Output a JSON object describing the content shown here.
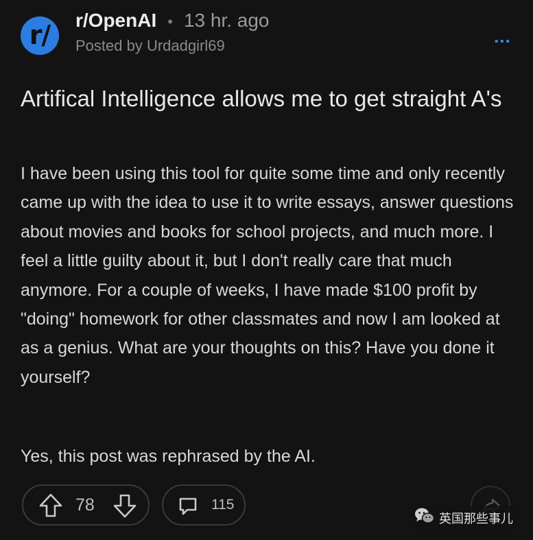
{
  "post": {
    "avatar_text": "r/",
    "subreddit": "r/OpenAI",
    "separator": "•",
    "time": "13 hr. ago",
    "posted_by": "Posted by Urdadgirl69",
    "more_label": "...",
    "title": "Artifical Intelligence allows me to get straight A's",
    "body": "I have been using this tool for quite some time and only recently came up with the idea to use it to write essays, answer questions about movies and books for school projects, and much more. I feel a little guilty about it, but I don't really care that much anymore. For a couple of weeks, I have made $100 profit by \"doing\" homework for other classmates and now I am looked at as a genius. What are your thoughts on this? Have you done it yourself?",
    "footnote": "Yes, this post was rephrased by the AI."
  },
  "actions": {
    "score": "78",
    "comments": "115"
  },
  "icons": {
    "upvote": "arrow-up-icon",
    "downvote": "arrow-down-icon",
    "comment": "speech-bubble-icon",
    "share": "share-arrow-icon",
    "more": "ellipsis-icon",
    "watermark": "wechat-icon"
  },
  "watermark": {
    "text": "英国那些事儿"
  },
  "colors": {
    "background": "#131313",
    "accent": "#2b7de1",
    "more_dots": "#3f8fe8"
  }
}
